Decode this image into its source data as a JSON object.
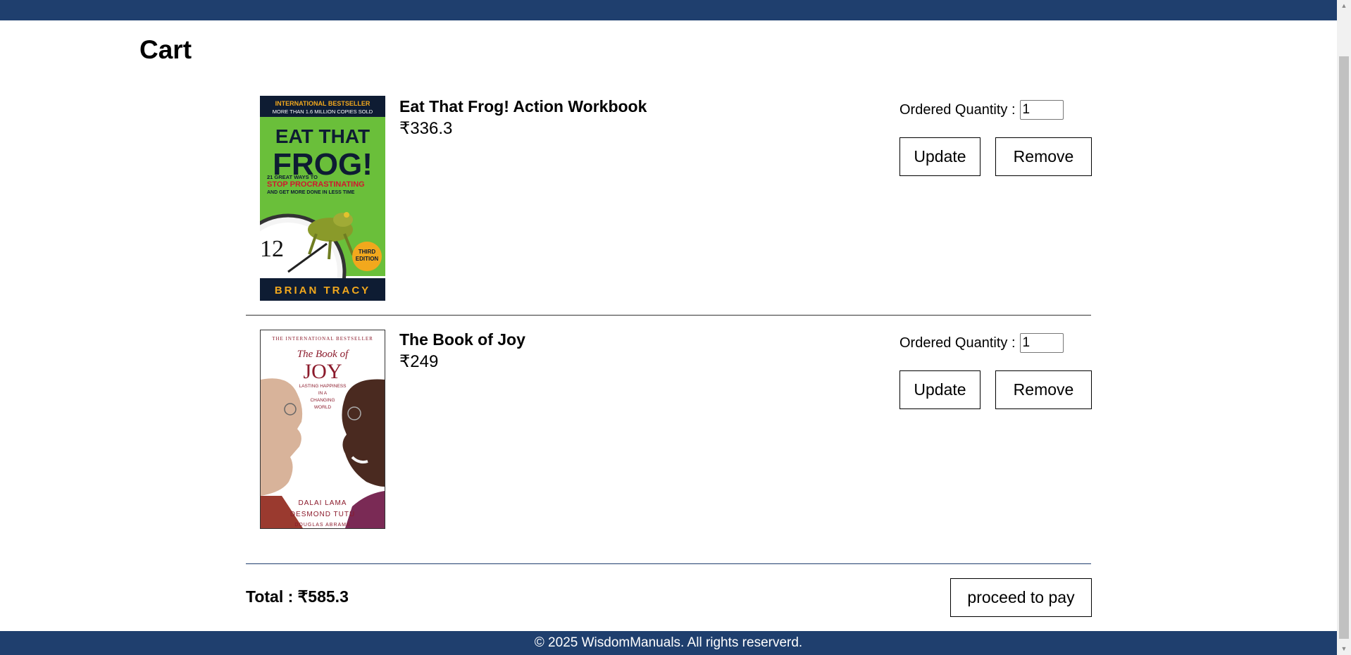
{
  "page": {
    "title": "Cart"
  },
  "cart": {
    "quantity_label": "Ordered Quantity :",
    "update_label": "Update",
    "remove_label": "Remove",
    "items": [
      {
        "title": "Eat That Frog! Action Workbook",
        "price": "₹336.3",
        "quantity": "1",
        "cover": {
          "top_line1": "INTERNATIONAL BESTSELLER",
          "top_line2": "MORE THAN 1.6 MILLION COPIES SOLD",
          "heading1": "EAT THAT",
          "heading2": "FROG!",
          "sub1": "21 GREAT WAYS TO",
          "sub2": "STOP PROCRASTINATING",
          "sub3": "AND GET MORE DONE IN LESS TIME",
          "badge1": "THIRD",
          "badge2": "EDITION",
          "author": "BRIAN TRACY"
        }
      },
      {
        "title": "The Book of Joy",
        "price": "₹249",
        "quantity": "1",
        "cover": {
          "top_line": "THE INTERNATIONAL BESTSELLER",
          "heading1": "The Book of",
          "heading2": "JOY",
          "sub1": "LASTING HAPPINESS",
          "sub2": "IN A",
          "sub3": "CHANGING",
          "sub4": "WORLD",
          "author1": "DALAI LAMA",
          "author2": "DESMOND TUTU",
          "author3": "DOUGLAS ABRAMS"
        }
      }
    ],
    "total_label": "Total : ₹585.3",
    "pay_label": "proceed to pay"
  },
  "footer": {
    "text": "© 2025 WisdomManuals. All rights reserverd."
  },
  "colors": {
    "brand": "#1f3f6e",
    "frog_green": "#6abf3a",
    "frog_navy": "#0e1c33",
    "joy_red": "#8b1a2b"
  }
}
